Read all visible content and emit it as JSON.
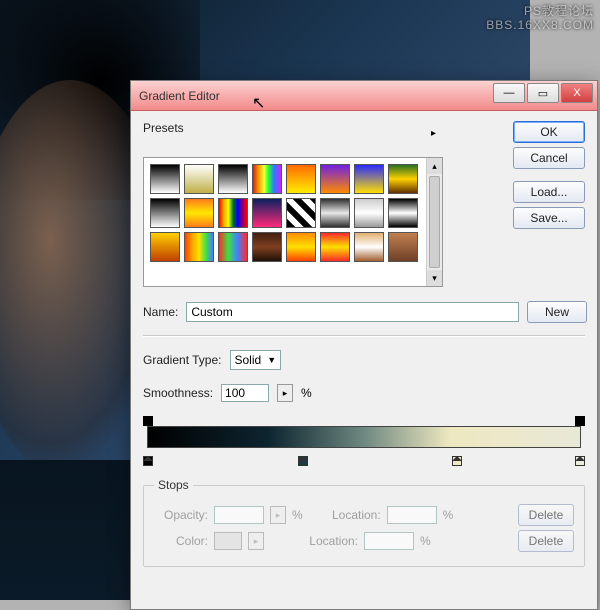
{
  "watermark": {
    "line1": "PS教程论坛",
    "line2": "BBS.16XX8.COM"
  },
  "dialog": {
    "title": "Gradient Editor",
    "winbtns": {
      "min": "—",
      "max": "▭",
      "close": "X"
    },
    "buttons": {
      "ok": "OK",
      "cancel": "Cancel",
      "load": "Load...",
      "save": "Save..."
    },
    "presets": {
      "label": "Presets",
      "arrow": "▸",
      "swatches": [
        "linear-gradient(#000,#fff)",
        "linear-gradient(#fff,#c0b048)",
        "linear-gradient(#000,transparent)",
        "linear-gradient(90deg,#d02020 0%,#ff9a00 20%,#f5ff38 40%,#2bff2b 55%,#2b7dff 75%,#c02bff 100%)",
        "linear-gradient(#ff6a00,#ffee00)",
        "linear-gradient(#7020e0,#ff8a00)",
        "linear-gradient(#2a2aff,#ffe000)",
        "linear-gradient(#2a7020,#ffd000,#603000)",
        "linear-gradient(#000,#fff)",
        "linear-gradient(#ff7b1a,#ffe800,#ff7b1a)",
        "linear-gradient(90deg,red,orange,yellow,green,blue,purple,red)",
        "linear-gradient(#0a2060,#ff2a7a)",
        "repeating-linear-gradient(45deg,#000 0 6px,#fff 6px 12px)",
        "linear-gradient(#303030,#e8e8e8,#303030)",
        "linear-gradient(#ccc,#fff,#999)",
        "linear-gradient(#000,#fff,#000)",
        "linear-gradient(#ffd000,#c04000)",
        "linear-gradient(90deg,#ff4000,#ffa000,#ffe000,#40e040,#4080ff)",
        "linear-gradient(90deg,#ff2a2a,#40e040,#4080ff,#ff2a2a)",
        "linear-gradient(#402010,#804020,#201008)",
        "linear-gradient(#ff8a00,#ffe000,#ff4000)",
        "linear-gradient(#ff2a2a,#ffe000,#ff2a2a)",
        "linear-gradient(#e0b070,#fff,#a06030)",
        "linear-gradient(#c08050,#704028)"
      ]
    },
    "name": {
      "label": "Name:",
      "value": "Custom",
      "new": "New"
    },
    "gradient_type": {
      "label": "Gradient Type:",
      "value": "Solid"
    },
    "smoothness": {
      "label": "Smoothness:",
      "value": "100",
      "unit": "%"
    },
    "gradient_bar": {
      "opacity_stops": [
        {
          "pos": 0
        },
        {
          "pos": 100
        }
      ],
      "color_stops": [
        {
          "pos": 0,
          "color": "#000"
        },
        {
          "pos": 35,
          "color": "#1c3a40"
        },
        {
          "pos": 70,
          "color": "#ece8c4"
        },
        {
          "pos": 100,
          "color": "#ececdc"
        }
      ]
    },
    "stops": {
      "legend": "Stops",
      "opacity_label": "Opacity:",
      "unit": "%",
      "location_label": "Location:",
      "color_label": "Color:",
      "delete": "Delete"
    }
  }
}
